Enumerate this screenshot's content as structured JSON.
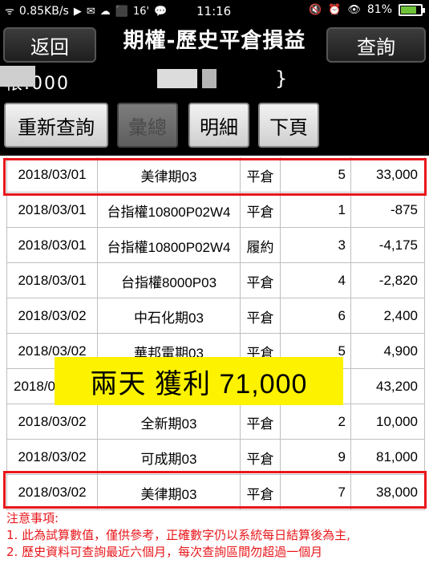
{
  "status_bar": {
    "signal": "ᯤ",
    "network_speed": "0.85KB/s",
    "icons_left": [
      "▶",
      "✉",
      "☁",
      "⬛",
      "16'",
      "💬"
    ],
    "time": "11:16",
    "icons_right": [
      "🔇",
      "⏰",
      "👁"
    ],
    "battery_percent": "81%",
    "battery_level": 0.81,
    "battery_color": "#6ec33b"
  },
  "header": {
    "back_label": "返回",
    "title": "期權-歷史平倉損益",
    "query_label": "查詢"
  },
  "account": {
    "text": "帳.000  ",
    "brace": "}"
  },
  "toolbar": {
    "requery_label": "重新查詢",
    "summary_label": "彙總",
    "detail_label": "明細",
    "next_page_label": "下頁"
  },
  "table": {
    "rows": [
      {
        "date": "2018/03/01",
        "name": "美律期03",
        "type": "平倉",
        "qty": "5",
        "pl": "33,000"
      },
      {
        "date": "2018/03/01",
        "name": "台指權10800P02W4",
        "type": "平倉",
        "qty": "1",
        "pl": "-875"
      },
      {
        "date": "2018/03/01",
        "name": "台指權10800P02W4",
        "type": "履約",
        "qty": "3",
        "pl": "-4,175"
      },
      {
        "date": "2018/03/01",
        "name": "台指權8000P03",
        "type": "平倉",
        "qty": "4",
        "pl": "-2,820"
      },
      {
        "date": "2018/03/02",
        "name": "中石化期03",
        "type": "平倉",
        "qty": "6",
        "pl": "2,400"
      },
      {
        "date": "2018/03/02",
        "name": "華邦電期03",
        "type": "平倉",
        "qty": "5",
        "pl": "4,900"
      },
      {
        "date": "2018/0",
        "name": "",
        "type": "",
        "qty": "",
        "pl": "43,200"
      },
      {
        "date": "2018/03/02",
        "name": "全新期03",
        "type": "平倉",
        "qty": "2",
        "pl": "10,000"
      },
      {
        "date": "2018/03/02",
        "name": "可成期03",
        "type": "平倉",
        "qty": "9",
        "pl": "81,000"
      },
      {
        "date": "2018/03/02",
        "name": "美律期03",
        "type": "平倉",
        "qty": "7",
        "pl": "38,000"
      }
    ]
  },
  "banner": {
    "text": "兩天 獲利 71,000",
    "color": "#fdf200"
  },
  "highlight_color": "#e8171b",
  "notes": {
    "heading": "注意事項:",
    "line1": "1. 此為試算數值，僅供參考，正確數字仍以系統每日結算後為主,",
    "line2": "2. 歷史資料可查詢最近六個月，每次查詢區間勿超過一個月"
  }
}
